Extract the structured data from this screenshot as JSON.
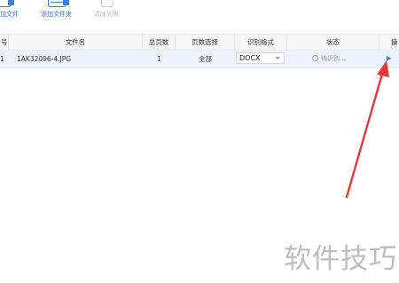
{
  "toolbar": {
    "add_file_label_partial": "加文件",
    "add_folder_label": "添加文件夹",
    "clear_list_label": "清除列表"
  },
  "table": {
    "columns": [
      "号",
      "文件名",
      "总页数",
      "页数选择",
      "识别格式",
      "状态",
      "操"
    ],
    "rows": [
      {
        "index": "1",
        "filename": "1AK32096-4.JPG",
        "pages": "1",
        "page_select": "全部",
        "format": "DOCX",
        "status": "待识别..."
      }
    ]
  },
  "watermark": "软件技巧",
  "colors": {
    "accent": "#3a80e0",
    "row_highlight": "#edf3fd",
    "arrow": "#e53935"
  }
}
